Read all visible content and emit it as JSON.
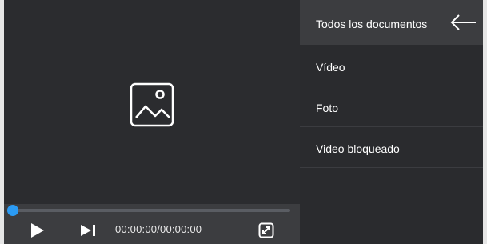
{
  "player": {
    "media_icon": "image-placeholder-icon",
    "time_display": "00:00:00/00:00:00",
    "progress": 0,
    "controls": {
      "play_icon": "play-icon",
      "next_icon": "skip-next-icon",
      "fullscreen_icon": "fullscreen-icon"
    },
    "accent_color": "#2b9bf4"
  },
  "sidebar": {
    "header": {
      "label": "Todos los documentos",
      "back_icon": "back-arrow-icon"
    },
    "items": [
      {
        "label": "Vídeo"
      },
      {
        "label": "Foto"
      },
      {
        "label": "Video bloqueado"
      }
    ]
  }
}
